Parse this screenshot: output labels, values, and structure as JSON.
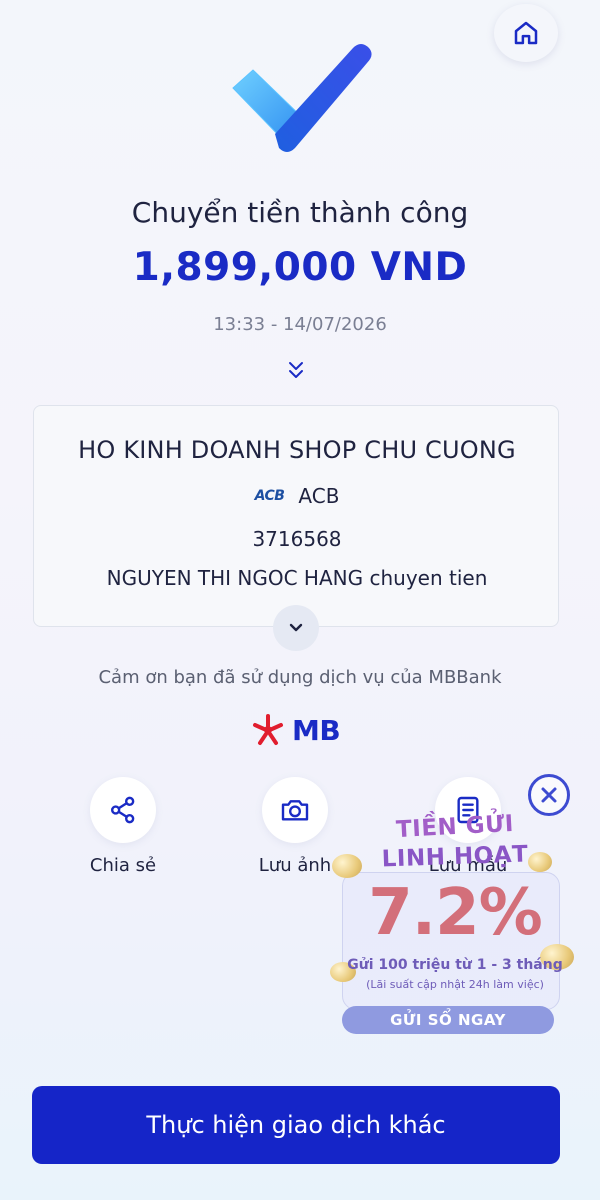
{
  "header": {
    "home_icon": "home-icon"
  },
  "status": {
    "icon": "success-check-icon",
    "title": "Chuyển tiền thành công",
    "amount": "1,899,000 VND",
    "datetime": "13:33 - 14/07/2026",
    "expand_icon": "double-chevron-down-icon"
  },
  "recipient_card": {
    "name": "HO KINH DOANH SHOP CHU CUONG",
    "bank_logo": "ACB",
    "bank_name": "ACB",
    "account_number": "3716568",
    "memo": "NGUYEN THI NGOC HANG chuyen tien",
    "toggle_icon": "chevron-down-icon"
  },
  "thanks_text": "Cảm ơn bạn đã sử dụng dịch vụ của MBBank",
  "brand": {
    "logo_text": "MB",
    "star_color": "#e11d2e",
    "text_color": "#1a2bc5"
  },
  "actions": [
    {
      "label": "Chia sẻ",
      "icon": "share-icon"
    },
    {
      "label": "Lưu ảnh",
      "icon": "camera-icon"
    },
    {
      "label": "Lưu mẫu",
      "icon": "template-icon"
    }
  ],
  "promo": {
    "line1": "TIỀN GỬI",
    "line2": "LINH HOẠT",
    "rate": "7.2%",
    "sub1": "Gửi 100 triệu từ 1 - 3 tháng",
    "sub2": "(Lãi suất cập nhật 24h làm việc)",
    "cta": "GỬI SỔ NGAY",
    "close_icon": "close-circle-icon"
  },
  "primary_button": {
    "label": "Thực hiện giao dịch khác"
  },
  "colors": {
    "accent": "#1a2bc5",
    "button": "#1525c8"
  }
}
